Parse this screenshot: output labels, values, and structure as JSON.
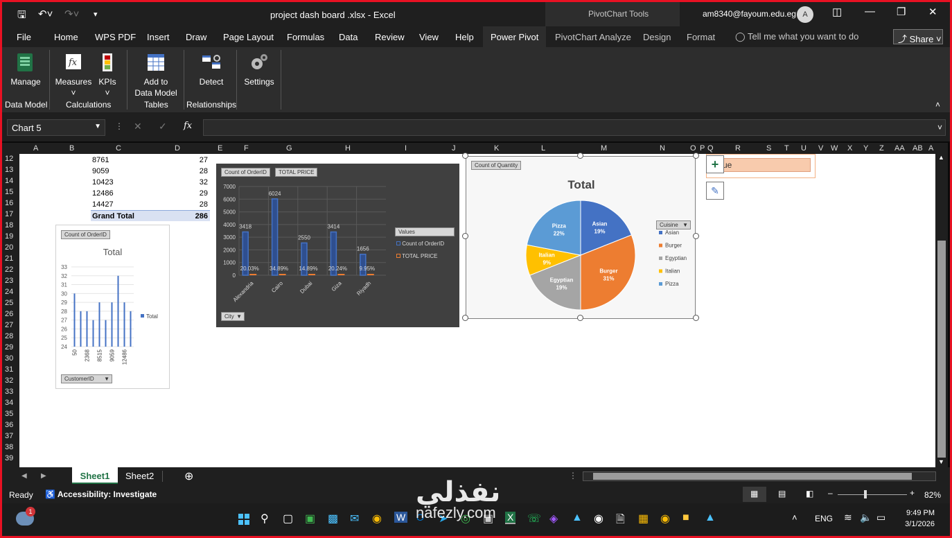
{
  "window": {
    "title": "project dash board .xlsx  -  Excel",
    "context_group": "PivotChart Tools",
    "user_email": "am8340@fayoum.edu.eg",
    "avatar_initial": "A"
  },
  "tabs": [
    "File",
    "Home",
    "WPS PDF",
    "Insert",
    "Draw",
    "Page Layout",
    "Formulas",
    "Data",
    "Review",
    "View",
    "Help",
    "Power Pivot",
    "PivotChart Analyze",
    "Design",
    "Format"
  ],
  "active_tab": "Power Pivot",
  "tell_me": "Tell me what you want to do",
  "share_label": "Share",
  "ribbon": {
    "buttons": {
      "manage": "Manage",
      "measures": "Measures",
      "kpis": "KPIs",
      "add_to": "Add to",
      "data_model": "Data Model",
      "detect": "Detect",
      "settings": "Settings"
    },
    "groups": {
      "data_model": "Data Model",
      "calculations": "Calculations",
      "tables": "Tables",
      "relationships": "Relationships"
    }
  },
  "formula_bar": {
    "name_box": "Chart 5",
    "fx": "fx"
  },
  "columns": [
    "A",
    "B",
    "C",
    "D",
    "E",
    "F",
    "G",
    "H",
    "I",
    "J",
    "K",
    "L",
    "M",
    "N",
    "O",
    "P",
    "Q",
    "R",
    "S",
    "T",
    "U",
    "V",
    "W",
    "X",
    "Y",
    "Z",
    "AA",
    "AB",
    "A"
  ],
  "rows": [
    "12",
    "13",
    "14",
    "15",
    "16",
    "17",
    "18",
    "19",
    "20",
    "21",
    "22",
    "23",
    "24",
    "25",
    "26",
    "27",
    "28",
    "29",
    "30",
    "31",
    "32",
    "33",
    "34",
    "35",
    "36",
    "37",
    "38",
    "39"
  ],
  "table": [
    {
      "id": "8761",
      "count": "27"
    },
    {
      "id": "9059",
      "count": "28"
    },
    {
      "id": "10423",
      "count": "32"
    },
    {
      "id": "12486",
      "count": "29"
    },
    {
      "id": "14427",
      "count": "28"
    }
  ],
  "grand_total": {
    "label": "Grand Total",
    "value": "286"
  },
  "chart_data": [
    {
      "type": "bar",
      "field_button": "Count of OrderID",
      "title": "Total",
      "categories": [
        "50",
        "2368",
        "8515",
        "9059",
        "12486"
      ],
      "x_all": [
        "50",
        "",
        "2368",
        "",
        "8515",
        "",
        "9059",
        "",
        "12486",
        ""
      ],
      "values": [
        30,
        28,
        28,
        27,
        29,
        27,
        29,
        32,
        29,
        28
      ],
      "series": [
        {
          "name": "Total"
        }
      ],
      "ylim": [
        24,
        33
      ],
      "yticks": [
        "24",
        "25",
        "26",
        "27",
        "28",
        "29",
        "30",
        "31",
        "32",
        "33"
      ],
      "axis_button": "CustomerID",
      "color": "#4472c4"
    },
    {
      "type": "bar",
      "field_buttons": [
        "Count of OrderID",
        "TOTAL  PRICE"
      ],
      "categories": [
        "Alexandria",
        "Cairo",
        "Dubai",
        "Giza",
        "Riyadh"
      ],
      "series": [
        {
          "name": "Count of OrderID",
          "values": [
            3418,
            6024,
            2550,
            3414,
            1656
          ],
          "color": "#4472c4"
        },
        {
          "name": "TOTAL  PRICE",
          "values": [
            20.03,
            34.89,
            14.89,
            20.24,
            9.95
          ],
          "labels": [
            "20.03%",
            "34.89%",
            "14.89%",
            "20.24%",
            "9.95%"
          ],
          "color": "#ed7d31"
        }
      ],
      "ylim": [
        0,
        7000
      ],
      "yticks": [
        "0",
        "1000",
        "2000",
        "3000",
        "4000",
        "5000",
        "6000",
        "7000"
      ],
      "legend_title": "Values",
      "axis_button": "City"
    },
    {
      "type": "pie",
      "field_button": "Count of Quantity",
      "title": "Total",
      "legend_title": "Cuisine",
      "slices": [
        {
          "label": "Asian",
          "pct": "19%",
          "value": 19,
          "color": "#4472c4"
        },
        {
          "label": "Burger",
          "pct": "31%",
          "value": 31,
          "color": "#ed7d31"
        },
        {
          "label": "Egyptian",
          "pct": "19%",
          "value": 19,
          "color": "#a5a5a5"
        },
        {
          "label": "Italian",
          "pct": "9%",
          "value": 9,
          "color": "#ffc000"
        },
        {
          "label": "Pizza",
          "pct": "22%",
          "value": 22,
          "color": "#5b9bd5"
        }
      ]
    }
  ],
  "chart_style_box": "ue",
  "sheets": [
    "Sheet1",
    "Sheet2"
  ],
  "active_sheet": "Sheet1",
  "status": {
    "ready": "Ready",
    "accessibility": "Accessibility: Investigate",
    "zoom": "82%"
  },
  "taskbar": {
    "lang": "ENG",
    "time": "9:49 PM",
    "date": "3/1/2026",
    "notif_count": "1"
  },
  "watermark": {
    "arabic": "نفذلي",
    "latin": "nafezly.com"
  }
}
